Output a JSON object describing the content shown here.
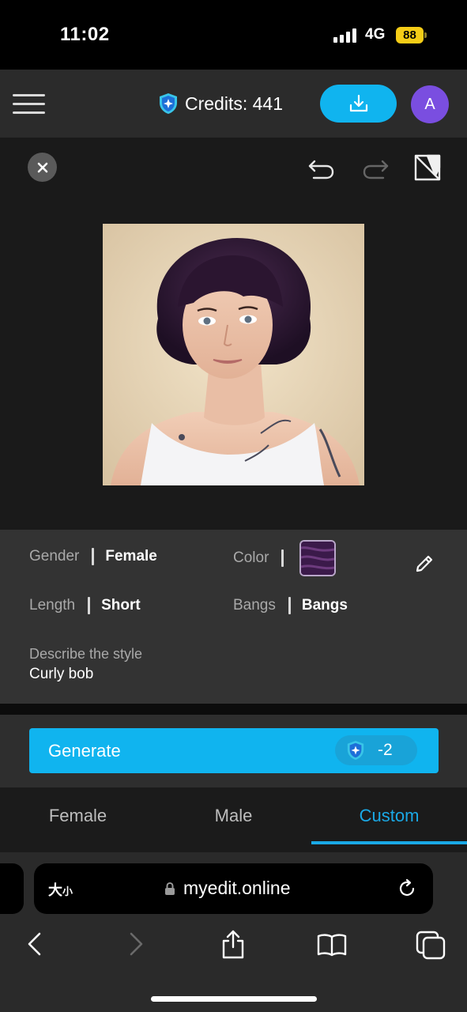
{
  "status": {
    "time": "11:02",
    "network": "4G",
    "battery": "88"
  },
  "header": {
    "credits_label": "Credits: 441",
    "avatar_initial": "A"
  },
  "editor": {
    "tools": [
      "undo-icon",
      "redo-icon",
      "compare-icon"
    ],
    "photo_alt": "generated-hairstyle-result"
  },
  "params": {
    "gender": {
      "label": "Gender",
      "value": "Female"
    },
    "color": {
      "label": "Color",
      "swatch": "#3b1a4a"
    },
    "length": {
      "label": "Length",
      "value": "Short"
    },
    "bangs": {
      "label": "Bangs",
      "value": "Bangs"
    },
    "describe": {
      "label": "Describe the style",
      "value": "Curly bob"
    }
  },
  "generate": {
    "label": "Generate",
    "cost": "-2"
  },
  "tabs": [
    {
      "label": "Female",
      "active": false
    },
    {
      "label": "Male",
      "active": false
    },
    {
      "label": "Custom",
      "active": true
    }
  ],
  "browser": {
    "text_size": "大",
    "text_size_small": "小",
    "url": "myedit.online"
  },
  "colors": {
    "accent": "#10b4ef",
    "avatar": "#7a4ee0",
    "battery": "#f5cd17"
  }
}
